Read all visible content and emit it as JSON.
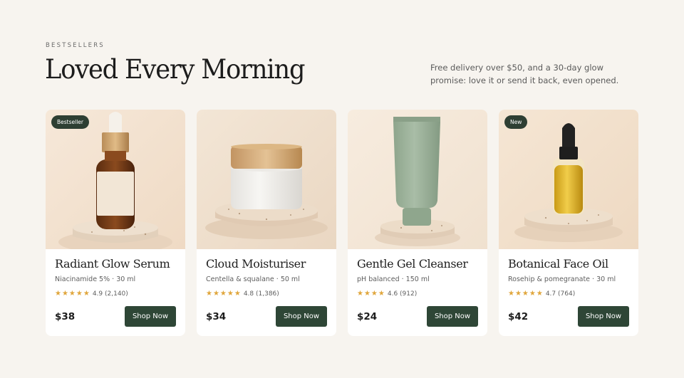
{
  "section": {
    "eyebrow": "BESTSELLERS",
    "title": "Loved Every Morning",
    "promo": "Free delivery over $50, and a 30-day glow promise: love it or send it back, even opened."
  },
  "colors": {
    "background": "#f7f4ef",
    "button": "#2e4636",
    "badge": "#2e3f33",
    "star": "#e0a63c"
  },
  "products": [
    {
      "name": "Radiant Glow Serum",
      "detail": "Niacinamide 5% · 30 ml",
      "badge": "Bestseller",
      "stars": "★★★★★",
      "rating_text": "4.9 (2,140)",
      "price": "$38",
      "cta": "Shop Now",
      "image": "amber-dropper-bottle-icon"
    },
    {
      "name": "Cloud Moisturiser",
      "detail": "Centella & squalane · 50 ml",
      "badge": "",
      "stars": "★★★★★",
      "rating_text": "4.8 (1,386)",
      "price": "$34",
      "cta": "Shop Now",
      "image": "cream-jar-icon"
    },
    {
      "name": "Gentle Gel Cleanser",
      "detail": "pH balanced · 150 ml",
      "badge": "",
      "stars": "★★★★",
      "rating_text": "4.6 (912)",
      "price": "$24",
      "cta": "Shop Now",
      "image": "sage-tube-icon"
    },
    {
      "name": "Botanical Face Oil",
      "detail": "Rosehip & pomegranate · 30 ml",
      "badge": "New",
      "stars": "★★★★★",
      "rating_text": "4.7 (764)",
      "price": "$42",
      "cta": "Shop Now",
      "image": "oil-dropper-bottle-icon"
    }
  ]
}
